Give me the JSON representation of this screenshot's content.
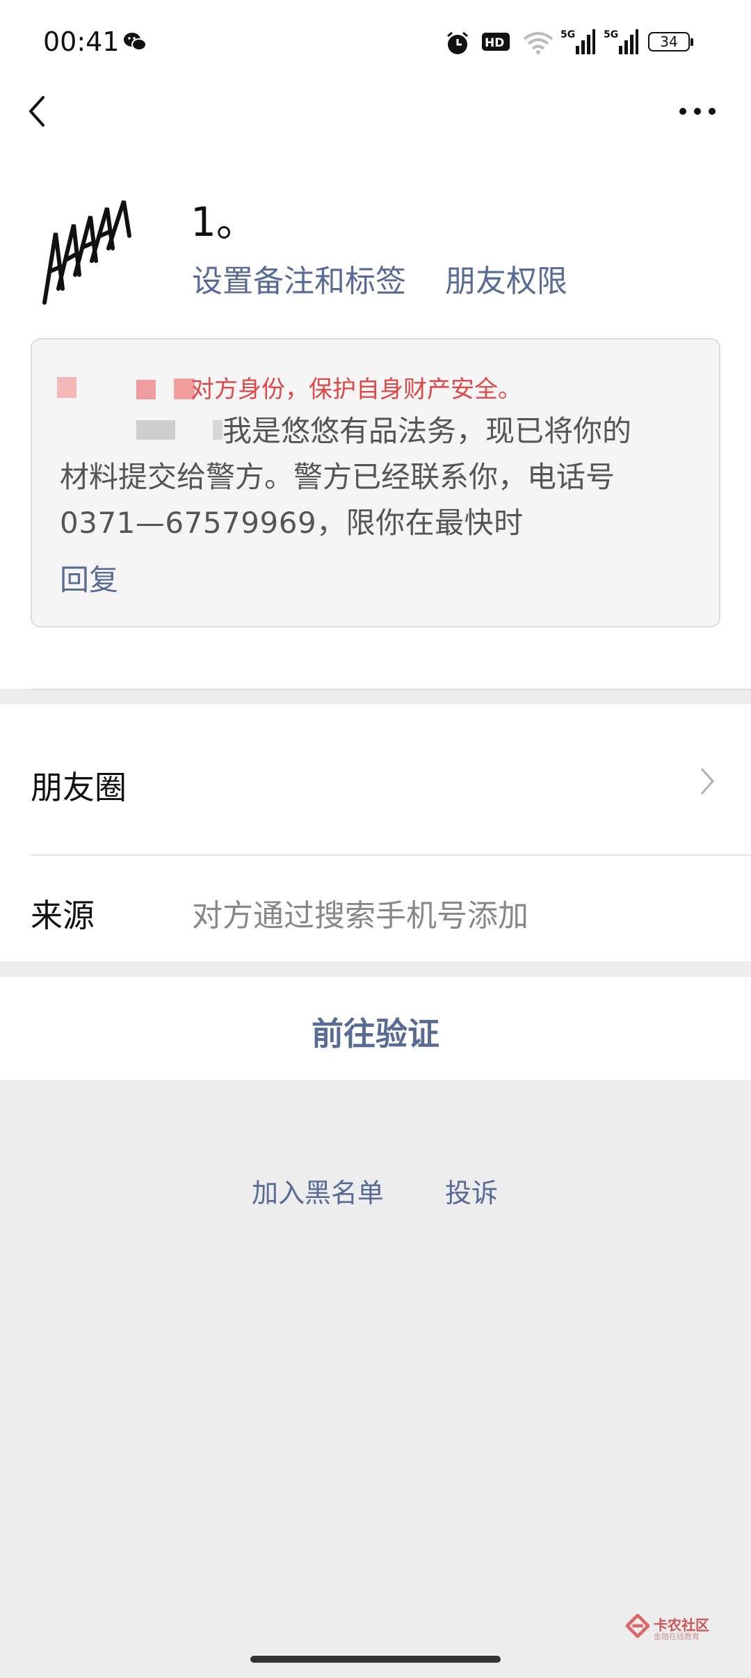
{
  "status_bar": {
    "time": "00:41",
    "battery": "34",
    "signal_1": "5G",
    "signal_2": "5G"
  },
  "profile": {
    "name": "1。",
    "avatar_text": "AAAAA",
    "remark_link": "设置备注和标签",
    "permission_link": "朋友权限"
  },
  "message": {
    "warning": "对方身份，保护自身财产安全。",
    "line1": "我是悠悠有品法务，现已将你的",
    "line2": "材料提交给警方。警方已经联系你，电话号",
    "line3": "0371—67579969，限你在最快时",
    "reply": "回复"
  },
  "list": {
    "moments_label": "朋友圈",
    "source_label": "来源",
    "source_value": "对方通过搜索手机号添加"
  },
  "actions": {
    "verify": "前往验证",
    "blacklist": "加入黑名单",
    "report": "投诉"
  },
  "watermark": {
    "name": "卡农社区",
    "sub": "金融在线教育"
  },
  "colors": {
    "link": "#576b95",
    "warning": "#e04848",
    "background": "#ededed"
  }
}
